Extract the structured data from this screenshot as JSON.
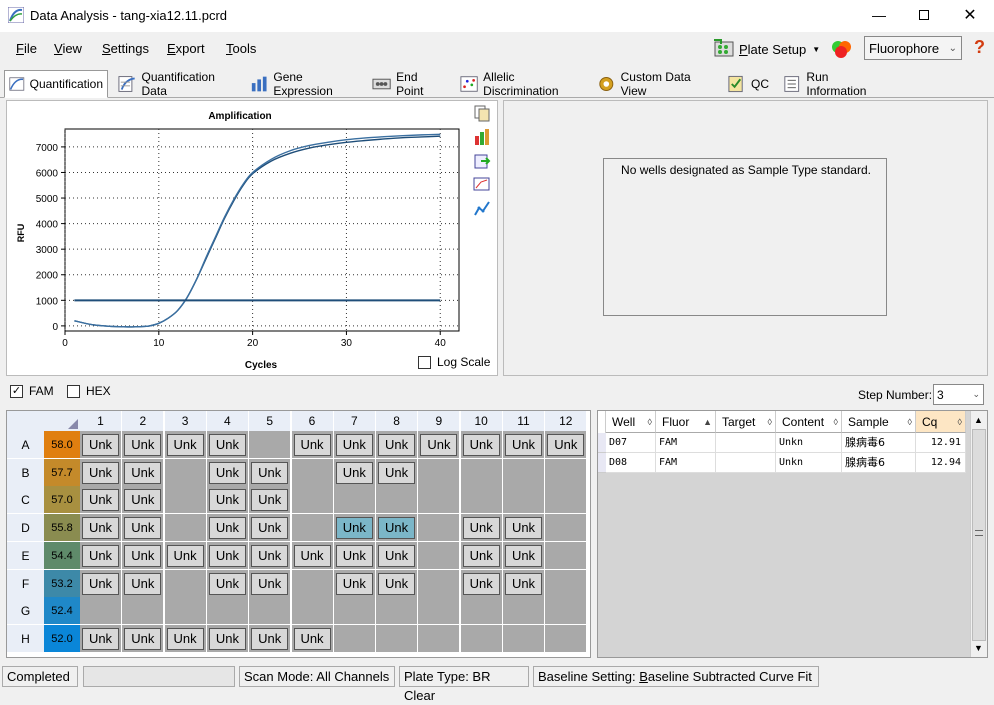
{
  "window": {
    "title": "Data Analysis - tang-xia12.11.pcrd"
  },
  "menu": [
    {
      "first": "F",
      "rest": "ile"
    },
    {
      "first": "V",
      "rest": "iew"
    },
    {
      "first": "S",
      "rest": "ettings"
    },
    {
      "first": "E",
      "rest": "xport"
    },
    {
      "first": "T",
      "rest": "ools"
    }
  ],
  "toolbar": {
    "plate_setup_first": "P",
    "plate_setup_rest": "late Setup",
    "fluor_select": "Fluorophore",
    "help": "?"
  },
  "tabs": [
    "Quantification",
    "Quantification Data",
    "Gene Expression",
    "End Point",
    "Allelic Discrimination",
    "Custom Data View",
    "QC",
    "Run Information"
  ],
  "chart": {
    "title": "Amplification",
    "xlabel": "Cycles",
    "ylabel": "RFU",
    "log_scale_label": "Log Scale",
    "xticks": [
      "0",
      "10",
      "20",
      "30",
      "40"
    ],
    "yticks": [
      "0",
      "1000",
      "2000",
      "3000",
      "4000",
      "5000",
      "6000",
      "7000"
    ]
  },
  "chart_data": {
    "type": "line",
    "title": "Amplification",
    "xlabel": "Cycles",
    "ylabel": "RFU",
    "xlim": [
      0,
      42
    ],
    "ylim": [
      -200,
      7700
    ],
    "grid": true,
    "series": [
      {
        "x": [
          1,
          3,
          5,
          7,
          8,
          9,
          10,
          11,
          12,
          13,
          14,
          15,
          16,
          17,
          18,
          19,
          20,
          22,
          24,
          26,
          28,
          30,
          32,
          34,
          36,
          38,
          40
        ],
        "values": [
          200,
          40,
          -20,
          -40,
          -30,
          0,
          100,
          300,
          600,
          1100,
          1800,
          2600,
          3400,
          4200,
          4900,
          5500,
          5950,
          6450,
          6750,
          6950,
          7080,
          7180,
          7250,
          7310,
          7360,
          7390,
          7420
        ]
      },
      {
        "x": [
          1,
          3,
          5,
          7,
          8,
          9,
          10,
          11,
          12,
          13,
          14,
          15,
          16,
          17,
          18,
          19,
          20,
          22,
          24,
          26,
          28,
          30,
          32,
          34,
          36,
          38,
          40
        ],
        "values": [
          200,
          40,
          -20,
          -40,
          -30,
          0,
          100,
          300,
          600,
          1100,
          1800,
          2650,
          3450,
          4250,
          4950,
          5550,
          6000,
          6520,
          6850,
          7050,
          7180,
          7280,
          7350,
          7400,
          7440,
          7470,
          7490
        ]
      },
      {
        "x": [
          1,
          40
        ],
        "values": [
          1000,
          1000
        ]
      }
    ]
  },
  "standards": {
    "message": "No wells designated as Sample Type standard."
  },
  "fluors": [
    {
      "label": "FAM",
      "checked": "✓"
    },
    {
      "label": "HEX",
      "checked": ""
    }
  ],
  "step": {
    "label": "Step Number:",
    "value": "3"
  },
  "plate": {
    "cols": [
      "1",
      "2",
      "3",
      "4",
      "5",
      "6",
      "7",
      "8",
      "9",
      "10",
      "11",
      "12"
    ],
    "rows": [
      {
        "label": "A",
        "temp": "58.0",
        "color": "#e07f10"
      },
      {
        "label": "B",
        "temp": "57.7",
        "color": "#c48a2a"
      },
      {
        "label": "C",
        "temp": "57.0",
        "color": "#a89040"
      },
      {
        "label": "D",
        "temp": "55.8",
        "color": "#8a8c50"
      },
      {
        "label": "E",
        "temp": "54.4",
        "color": "#5f8a6a"
      },
      {
        "label": "F",
        "temp": "53.2",
        "color": "#3d89a8"
      },
      {
        "label": "G",
        "temp": "52.4",
        "color": "#1f88c8"
      },
      {
        "label": "H",
        "temp": "52.0",
        "color": "#0a86d8"
      }
    ],
    "wells": [
      [
        "Unk",
        "Unk",
        "Unk",
        "Unk",
        "",
        "Unk",
        "Unk",
        "Unk",
        "Unk",
        "Unk",
        "Unk",
        "Unk"
      ],
      [
        "Unk",
        "Unk",
        "",
        "Unk",
        "Unk",
        "",
        "Unk",
        "Unk",
        "",
        "",
        "",
        ""
      ],
      [
        "Unk",
        "Unk",
        "",
        "Unk",
        "Unk",
        "",
        "",
        "",
        "",
        "",
        "",
        ""
      ],
      [
        "Unk",
        "Unk",
        "",
        "Unk",
        "Unk",
        "",
        "Unk",
        "Unk",
        "",
        "Unk",
        "Unk",
        ""
      ],
      [
        "Unk",
        "Unk",
        "Unk",
        "Unk",
        "Unk",
        "Unk",
        "Unk",
        "Unk",
        "",
        "Unk",
        "Unk",
        ""
      ],
      [
        "Unk",
        "Unk",
        "",
        "Unk",
        "Unk",
        "",
        "Unk",
        "Unk",
        "",
        "Unk",
        "Unk",
        ""
      ],
      [
        "",
        "",
        "",
        "",
        "",
        "",
        "",
        "",
        "",
        "",
        "",
        ""
      ],
      [
        "Unk",
        "Unk",
        "Unk",
        "Unk",
        "Unk",
        "Unk",
        "",
        "",
        "",
        "",
        "",
        ""
      ]
    ],
    "selected": [
      "D7",
      "D8"
    ]
  },
  "results": {
    "headers": [
      "Well",
      "Fluor",
      "Target",
      "Content",
      "Sample",
      "Cq"
    ],
    "rows": [
      [
        "D07",
        "FAM",
        "",
        "Unkn",
        "腺病毒6",
        "12.91"
      ],
      [
        "D08",
        "FAM",
        "",
        "Unkn",
        "腺病毒6",
        "12.94"
      ]
    ]
  },
  "status": {
    "state": "Completed",
    "scan_mode": "Scan Mode: All Channels",
    "plate_type": "Plate Type: BR Clear",
    "baseline_prefix": "Baseline Setting: ",
    "baseline_first": "B",
    "baseline_rest": "aseline Subtracted Curve Fit"
  }
}
